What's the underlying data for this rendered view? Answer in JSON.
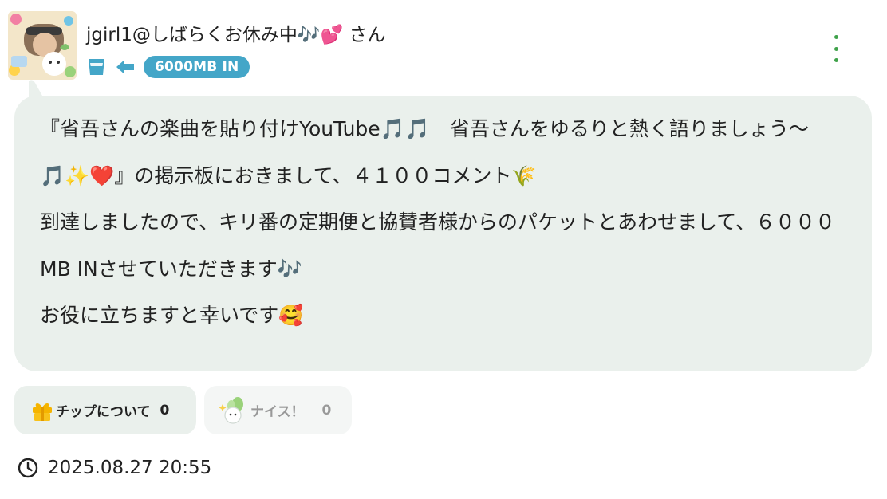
{
  "post": {
    "username": "jgirl1@しばらくお休み中🎶💕 さん",
    "badge": "6000MB IN",
    "message_lines": [
      "『省吾さんの楽曲を貼り付けYouTube🎵🎵　省吾さんをゆるりと熱く語りましょう〜🎵✨❤️』の掲示板におきまして、４１００コメント🌾",
      "到達しましたので、キリ番の定期便と協賛者様からのパケットとあわせまして、６０００MB INさせていただきます🎶",
      "お役に立ちますと幸いです🥰"
    ],
    "timestamp": "2025.08.27 20:55"
  },
  "reactions": {
    "tip": {
      "label": "チップについて",
      "count": "0",
      "icon": "gift-icon"
    },
    "nice": {
      "label": "ナイス！",
      "count": "0",
      "icon": "bunny-icon"
    }
  },
  "icons": {
    "glass": "glass-icon",
    "arrow": "arrow-left-icon",
    "more": "more-vertical-icon",
    "clock": "clock-icon"
  },
  "colors": {
    "badge": "#44a6c8",
    "bubble": "#eaf0ec",
    "more_dots": "#3fa24a",
    "tip_chip": "#eaf0ec",
    "nice_chip": "#f4f6f5"
  }
}
